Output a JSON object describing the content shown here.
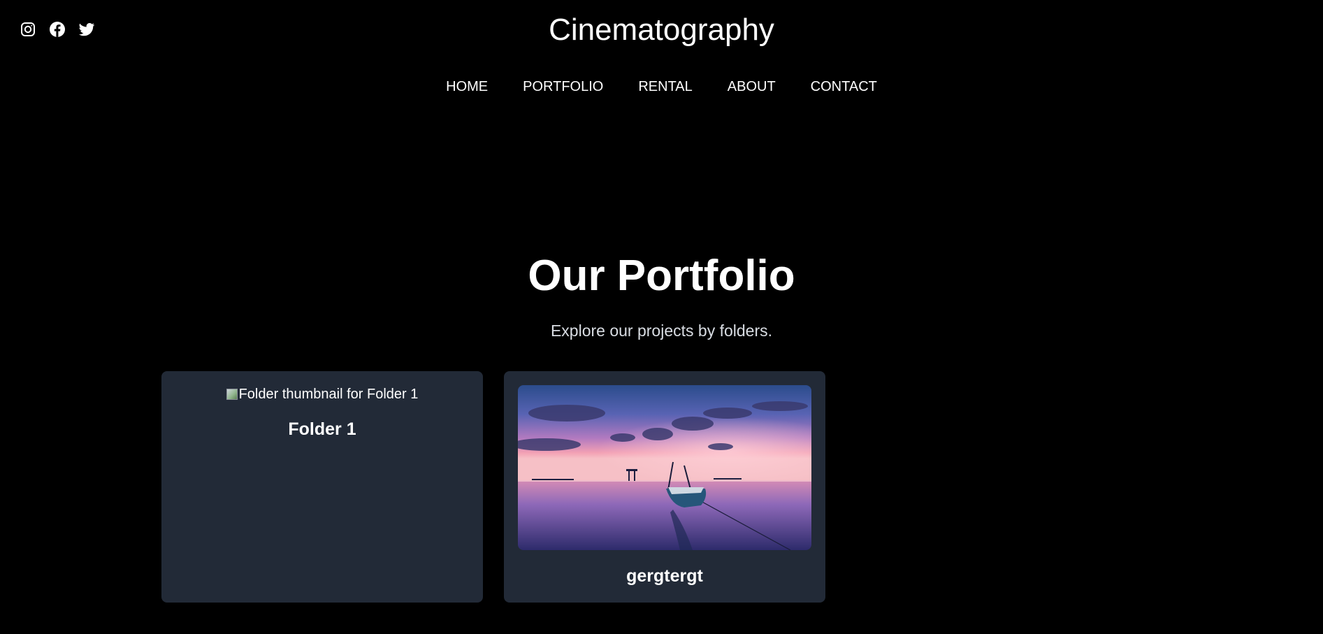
{
  "header": {
    "site_title": "Cinematography",
    "social": [
      "instagram-icon",
      "facebook-icon",
      "twitter-icon"
    ]
  },
  "nav": {
    "items": [
      "HOME",
      "PORTFOLIO",
      "RENTAL",
      "ABOUT",
      "CONTACT"
    ]
  },
  "hero": {
    "title": "Our Portfolio",
    "subtitle": "Explore our projects by folders."
  },
  "folders": [
    {
      "title": "Folder 1",
      "thumbnail_alt": "Folder thumbnail for Folder 1",
      "thumbnail_loaded": false
    },
    {
      "title": "gergtergt",
      "thumbnail_loaded": true
    }
  ],
  "colors": {
    "background": "#000000",
    "card": "#222a37",
    "text": "#ffffff"
  }
}
